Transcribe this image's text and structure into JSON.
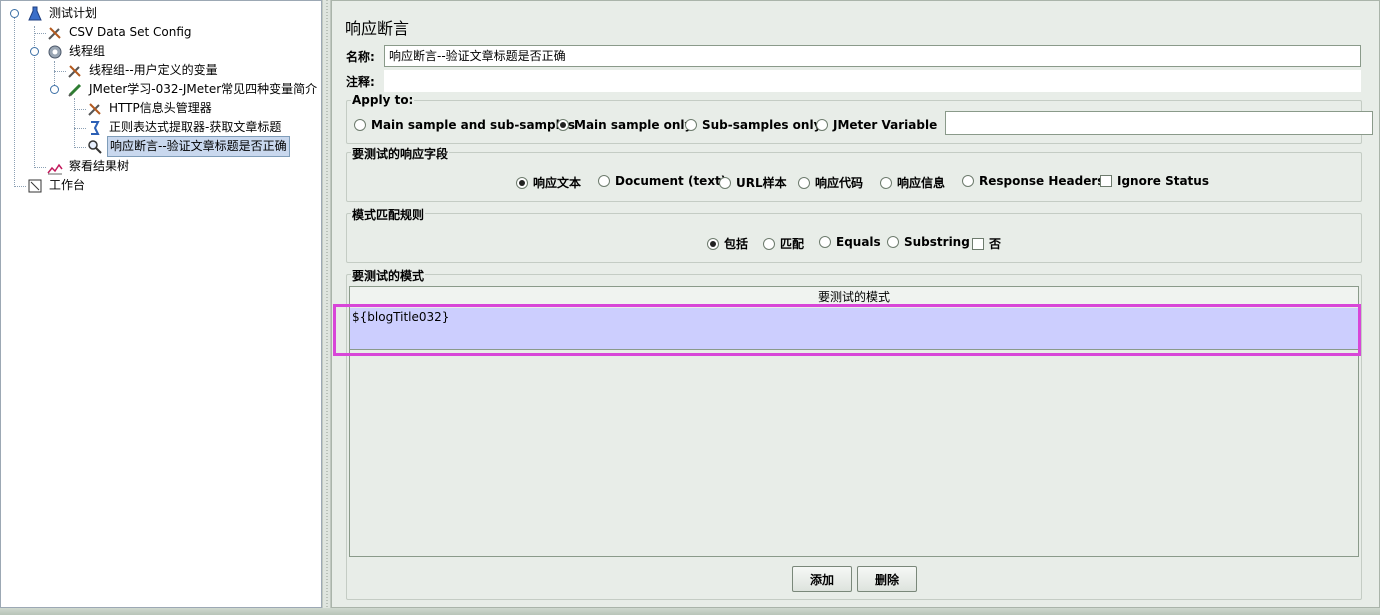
{
  "tree": {
    "items": [
      {
        "label": "测试计划",
        "icon": "flask-icon"
      },
      {
        "label": "CSV Data Set Config",
        "icon": "tools-icon"
      },
      {
        "label": "线程组",
        "icon": "gear-icon"
      },
      {
        "label": "线程组--用户定义的变量",
        "icon": "tools-icon"
      },
      {
        "label": "JMeter学习-032-JMeter常见四种变量简介",
        "icon": "pipette-icon"
      },
      {
        "label": "HTTP信息头管理器",
        "icon": "tools-icon"
      },
      {
        "label": "正则表达式提取器-获取文章标题",
        "icon": "arrow-icon"
      },
      {
        "label": "响应断言--验证文章标题是否正确",
        "icon": "magnifier-icon"
      },
      {
        "label": "察看结果树",
        "icon": "graph-icon"
      },
      {
        "label": "工作台",
        "icon": "workbench-icon"
      }
    ]
  },
  "panel": {
    "title": "响应断言",
    "name_label": "名称:",
    "name_value": "响应断言--验证文章标题是否正确",
    "comment_label": "注释:",
    "comment_value": ""
  },
  "apply_to": {
    "title": "Apply to:",
    "options": [
      "Main sample and sub-samples",
      "Main sample only",
      "Sub-samples only",
      "JMeter Variable"
    ],
    "selected": "Main sample only",
    "variable_value": ""
  },
  "response_field": {
    "title": "要测试的响应字段",
    "options": [
      "响应文本",
      "Document (text)",
      "URL样本",
      "响应代码",
      "响应信息",
      "Response Headers"
    ],
    "selected": "响应文本",
    "ignore_status_label": "Ignore Status",
    "ignore_status_checked": false
  },
  "pattern_rule": {
    "title": "模式匹配规则",
    "options": [
      "包括",
      "匹配",
      "Equals",
      "Substring"
    ],
    "selected": "包括",
    "not_label": "否",
    "not_checked": false
  },
  "patterns": {
    "title": "要测试的模式",
    "column_header": "要测试的模式",
    "rows": [
      "${blogTitle032}"
    ]
  },
  "buttons": {
    "add": "添加",
    "delete": "删除"
  },
  "colors": {
    "selected_row": "#cccefe",
    "highlight": "#d846d8",
    "panel_bg": "#e8ede8"
  }
}
